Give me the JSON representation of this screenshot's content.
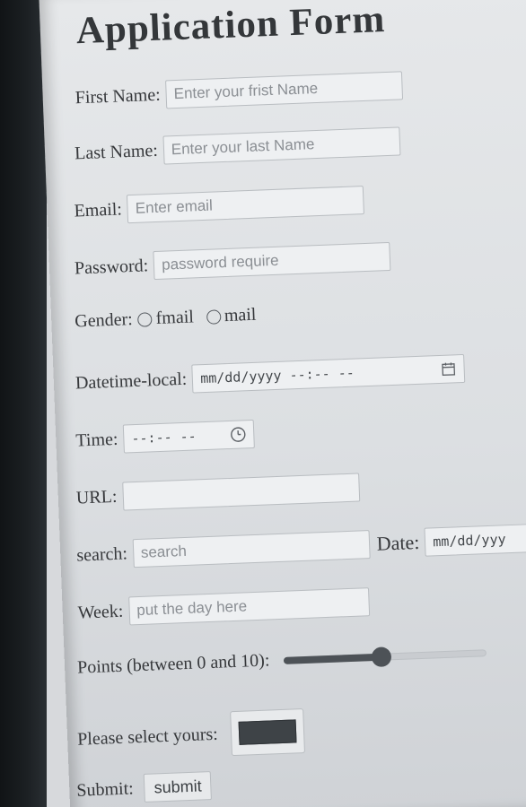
{
  "title": "Application Form",
  "fields": {
    "first_name": {
      "label": "First Name:",
      "placeholder": "Enter your frist Name"
    },
    "last_name": {
      "label": "Last Name:",
      "placeholder": "Enter your last Name"
    },
    "email": {
      "label": "Email:",
      "placeholder": "Enter email"
    },
    "password": {
      "label": "Password:",
      "placeholder": "password require"
    },
    "gender": {
      "label": "Gender:",
      "options": [
        "fmail",
        "mail"
      ]
    },
    "datetime_local": {
      "label": "Datetime-local:",
      "placeholder": "mm/dd/yyyy --:-- --",
      "icon": "calendar-icon"
    },
    "time": {
      "label": "Time:",
      "placeholder": "--:-- --",
      "icon": "clock-icon"
    },
    "url": {
      "label": "URL:",
      "value": ""
    },
    "search": {
      "label": "search:",
      "placeholder": "search"
    },
    "date": {
      "label": "Date:",
      "placeholder": "mm/dd/yyy"
    },
    "week": {
      "label": "Week:",
      "placeholder": "put the day here"
    },
    "points": {
      "label": "Points (between 0 and 10):",
      "value_fraction": 0.48,
      "track_color": "#c9ccd0",
      "fill_color": "#4d5257"
    },
    "color": {
      "label": "Please select yours:",
      "value": "#3e4347"
    },
    "submit": {
      "label": "Submit:",
      "button_label": "submit"
    }
  }
}
